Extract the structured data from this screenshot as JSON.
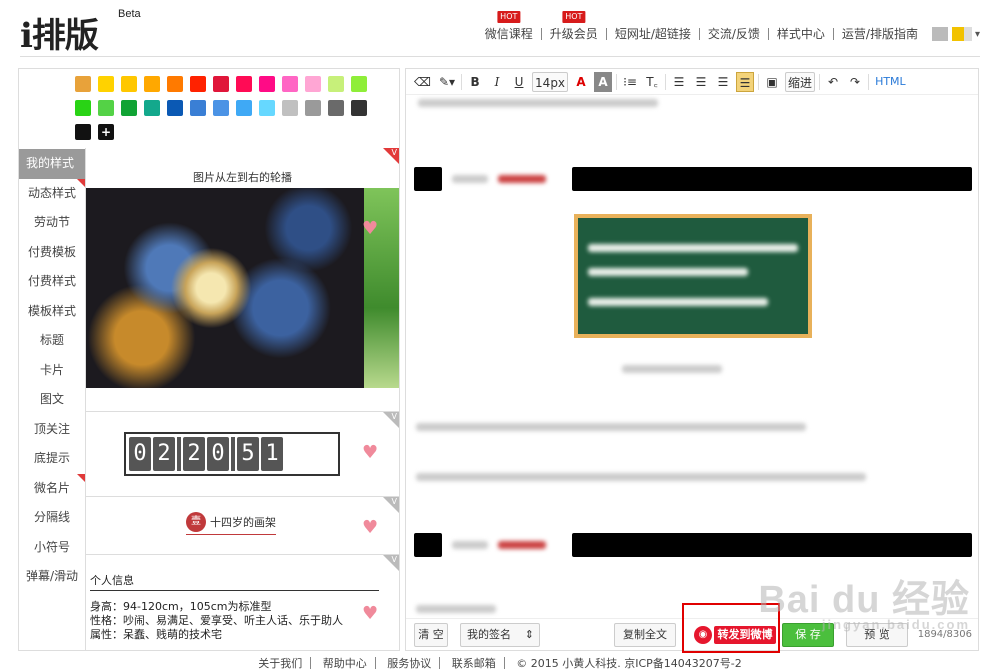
{
  "header": {
    "logo": "i排版",
    "logo_sup": "Beta",
    "nav": [
      {
        "label": "微信课程",
        "hot": "HOT"
      },
      {
        "label": "升级会员",
        "hot": "HOT"
      },
      {
        "label": "短网址/超链接"
      },
      {
        "label": "交流/反馈"
      },
      {
        "label": "样式中心"
      },
      {
        "label": "运营/排版指南"
      }
    ],
    "caret": "▾"
  },
  "left": {
    "swatches": [
      "#e8a23a",
      "#ffd200",
      "#ffc700",
      "#ffa800",
      "#ff7a00",
      "#ff2200",
      "#e0163a",
      "#ff0b55",
      "#ff0b86",
      "#ff66c4",
      "#ffa6d4",
      "#c7f07a",
      "#8fee39",
      "#29d315",
      "#54d246",
      "#10a334",
      "#13a88c",
      "#0b59b4",
      "#3a7fd5",
      "#4b93e5",
      "#3fa9f5",
      "#66d8ff",
      "#c0c0c0",
      "#9a9a9a",
      "#6a6a6a",
      "#333333",
      "#111111"
    ],
    "plus": "+",
    "categories": [
      "我的样式",
      "动态样式",
      "劳动节",
      "付费模板",
      "付费样式",
      "模板样式",
      "标题",
      "卡片",
      "图文",
      "顶关注",
      "底提示",
      "微名片",
      "分隔线",
      "小符号",
      "弹幕/滑动"
    ],
    "card1_caption": "图片从左到右的轮播",
    "counter_digits": [
      "0",
      "2",
      "2",
      "0",
      "5",
      "1"
    ],
    "badge_dot": "壹",
    "badge_text": "十四岁的画架",
    "info_title": "个人信息",
    "info_lines": [
      "身高：94-120cm，105cm为标准型",
      "性格：吵闹、易满足、爱享受、听主人话、乐于助人",
      "属性：呆蠢、贱萌的技术宅"
    ],
    "corner_mark": "V"
  },
  "toolbar": {
    "fontsize": "14px",
    "bold": "B",
    "italic": "I",
    "underline": "U",
    "fontcolor": "A",
    "bgcolor": "A",
    "list": "⁝≡",
    "heading": "T꜀",
    "indent": "缩进",
    "html": "HTML",
    "undo": "↶",
    "redo": "↷"
  },
  "bottom": {
    "clear": "清 空",
    "signature": "我的签名",
    "copy_all": "复制全文",
    "weibo": "转发到微博",
    "save": "保 存",
    "preview": "预 览",
    "count": "1894/8306"
  },
  "watermark": {
    "main": "Bai du 经验",
    "sub": "jingyan.baidu.com"
  },
  "footer": [
    "关于我们",
    "帮助中心",
    "服务协议",
    "联系邮箱",
    "© 2015 小黄人科技. 京ICP备14043207号-2"
  ]
}
